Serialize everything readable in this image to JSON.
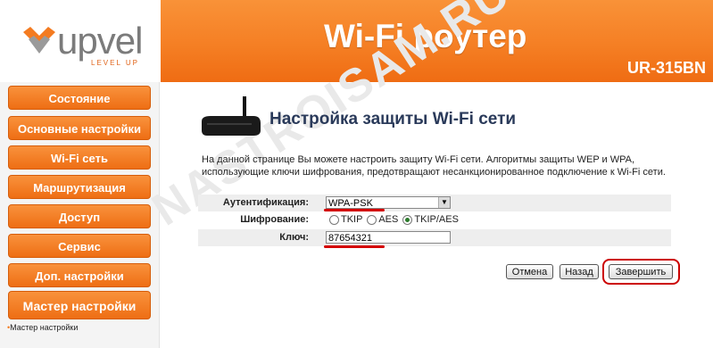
{
  "brand": {
    "name": "upvel",
    "tagline": "LEVEL UP"
  },
  "header": {
    "title": "Wi-Fi роутер",
    "model": "UR-315BN"
  },
  "sidebar": {
    "items": [
      {
        "label": "Состояние"
      },
      {
        "label": "Основные настройки"
      },
      {
        "label": "Wi-Fi сеть"
      },
      {
        "label": "Маршрутизация"
      },
      {
        "label": "Доступ"
      },
      {
        "label": "Сервис"
      },
      {
        "label": "Доп. настройки"
      },
      {
        "label": "Мастер настройки"
      }
    ],
    "subitem": "Мастер настройки"
  },
  "page": {
    "title": "Настройка защиты Wi-Fi сети",
    "description": "На данной странице Вы можете настроить защиту Wi-Fi сети. Алгоритмы защиты WEP и WPA, использующие ключи шифрования, предотвращают несанкционированное подключение к Wi-Fi сети."
  },
  "form": {
    "auth_label": "Аутентификация:",
    "auth_value": "WPA-PSK",
    "encryption_label": "Шифрование:",
    "encryption_options": [
      "TKIP",
      "AES",
      "TKIP/AES"
    ],
    "encryption_selected": "TKIP/AES",
    "key_label": "Ключ:",
    "key_value": "87654321"
  },
  "buttons": {
    "cancel": "Отмена",
    "back": "Назад",
    "finish": "Завершить"
  },
  "watermark": "NASTROISAM.RU",
  "colors": {
    "accent": "#f57f24",
    "highlight": "#cc0000"
  }
}
